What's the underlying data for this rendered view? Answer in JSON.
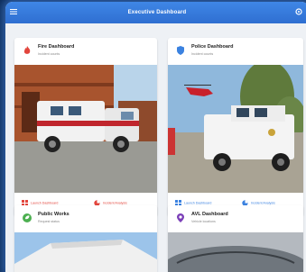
{
  "header": {
    "title": "Executive Dashboard"
  },
  "cards": [
    {
      "name": "Fire Dashboard",
      "subtitle": "Incident counts",
      "actions": [
        {
          "label": "Launch Dashboard"
        },
        {
          "label": "Incident Analysis"
        }
      ]
    },
    {
      "name": "Police Dashboard",
      "subtitle": "Incident counts",
      "actions": [
        {
          "label": "Launch Dashboard"
        },
        {
          "label": "Incident Analysis"
        }
      ]
    },
    {
      "name": "Public Works",
      "subtitle": "Request status"
    },
    {
      "name": "AVL Dashboard",
      "subtitle": "Vehicle locations"
    }
  ],
  "colors": {
    "header": "#3a80e3",
    "fire_accent": "#e2453c",
    "police_accent": "#3b82e0",
    "works_accent": "#4caf50",
    "avl_accent": "#7b3fb8"
  },
  "icons": {
    "fire": "flame-icon",
    "police": "shield-icon",
    "works": "leaf-icon",
    "avl": "map-pin-icon"
  }
}
